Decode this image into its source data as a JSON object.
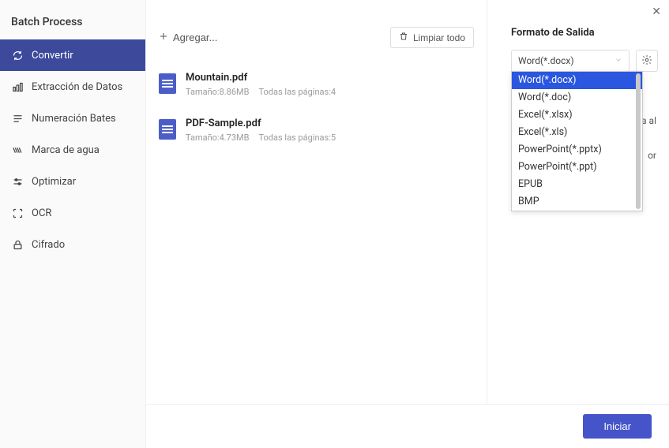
{
  "window": {
    "title": "Batch Process"
  },
  "sidebar": {
    "items": [
      {
        "label": "Convertir"
      },
      {
        "label": "Extracción de Datos"
      },
      {
        "label": "Numeración Bates"
      },
      {
        "label": "Marca de agua"
      },
      {
        "label": "Optimizar"
      },
      {
        "label": "OCR"
      },
      {
        "label": "Cifrado"
      }
    ]
  },
  "toolbar": {
    "add_label": "Agregar...",
    "clear_label": "Limpiar todo"
  },
  "files": [
    {
      "name": "Mountain.pdf",
      "size": "Tamaño:8.86MB",
      "pages": "Todas las páginas:4"
    },
    {
      "name": "PDF-Sample.pdf",
      "size": "Tamaño:4.73MB",
      "pages": "Todas las páginas:5"
    }
  ],
  "right": {
    "title": "Formato de Salida",
    "selected": "Word(*.docx)",
    "options": [
      "Word(*.docx)",
      "Word(*.doc)",
      "Excel(*.xlsx)",
      "Excel(*.xls)",
      "PowerPoint(*.pptx)",
      "PowerPoint(*.ppt)",
      "EPUB",
      "BMP"
    ],
    "behind_fragment_1": "ada al",
    "behind_fragment_2": "or"
  },
  "footer": {
    "start_label": "Iniciar"
  }
}
